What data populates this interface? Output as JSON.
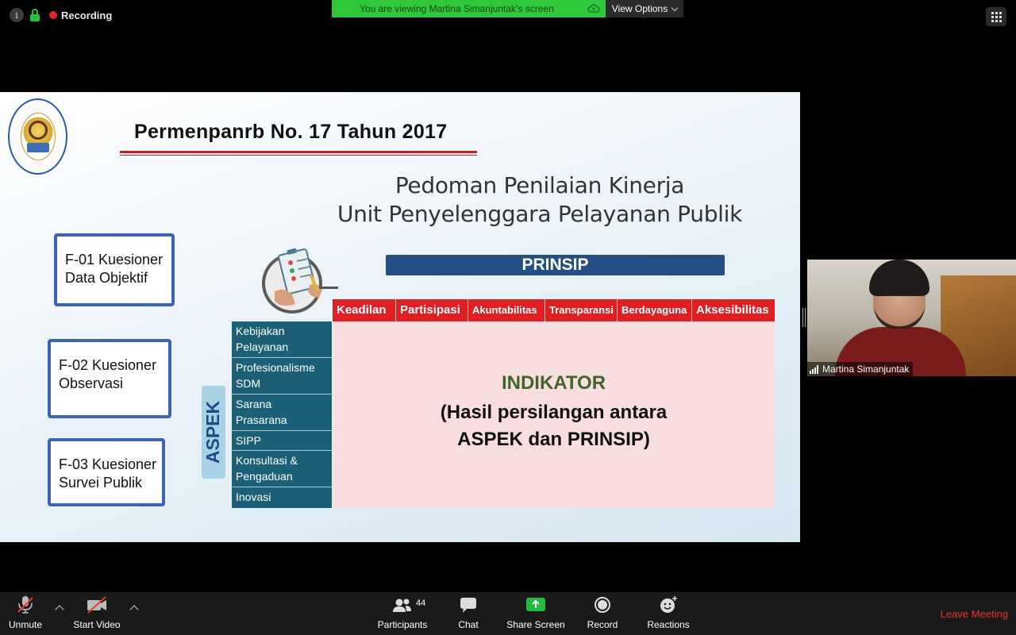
{
  "topbar": {
    "recording_label": "Recording",
    "banner_text": "You are viewing Martina Simanjuntak’s screen",
    "view_options_label": "View Options",
    "icons": [
      "info-icon",
      "lock-icon",
      "recording-dot-icon",
      "cloud-icon",
      "chevron-down-icon",
      "gallery-grid-icon"
    ]
  },
  "slide": {
    "title": "Permenpanrb No. 17 Tahun 2017",
    "subtitle_line1": "Pedoman Penilaian Kinerja",
    "subtitle_line2": "Unit Penyelenggara Pelayanan Publik",
    "forms": [
      {
        "line1": "F-01 Kuesioner",
        "line2": "Data Objektif"
      },
      {
        "line1": "F-02 Kuesioner",
        "line2": "Observasi"
      },
      {
        "line1": "F-03 Kuesioner",
        "line2": "Survei Publik"
      }
    ],
    "aspek_label": "ASPEK",
    "prinsip_label": "PRINSIP",
    "principles": [
      "Keadilan",
      "Partisipasi",
      "Akuntabilitas",
      "Transparansi",
      "Berdayaguna",
      "Aksesibilitas"
    ],
    "aspects": [
      {
        "line1": "Kebijakan",
        "line2": "Pelayanan"
      },
      {
        "line1": "Profesionalisme",
        "line2": "SDM"
      },
      {
        "line1": "Sarana",
        "line2": "Prasarana"
      },
      {
        "line1": "SIPP",
        "line2": ""
      },
      {
        "line1": "Konsultasi &",
        "line2": "Pengaduan"
      },
      {
        "line1": "Inovasi",
        "line2": ""
      }
    ],
    "indikator_title": "INDIKATOR",
    "indikator_line1": "(Hasil persilangan antara",
    "indikator_line2": "ASPEK dan PRINSIP)",
    "colors": {
      "principle_red": "#e01f22",
      "aspect_teal": "#1c6078",
      "prinsip_navy": "#254e84",
      "indikator_pink": "#f8dede",
      "indikator_green": "#43652c"
    }
  },
  "video": {
    "participant_name": "Martina Simanjuntak"
  },
  "toolbar": {
    "unmute": "Unmute",
    "start_video": "Start Video",
    "participants": "Participants",
    "participants_count": "44",
    "chat": "Chat",
    "share_screen": "Share Screen",
    "record": "Record",
    "reactions": "Reactions",
    "leave": "Leave Meeting",
    "colors": {
      "share_green": "#1fbd3c",
      "leave_red": "#e8332a",
      "muted_red": "#e53935"
    }
  }
}
